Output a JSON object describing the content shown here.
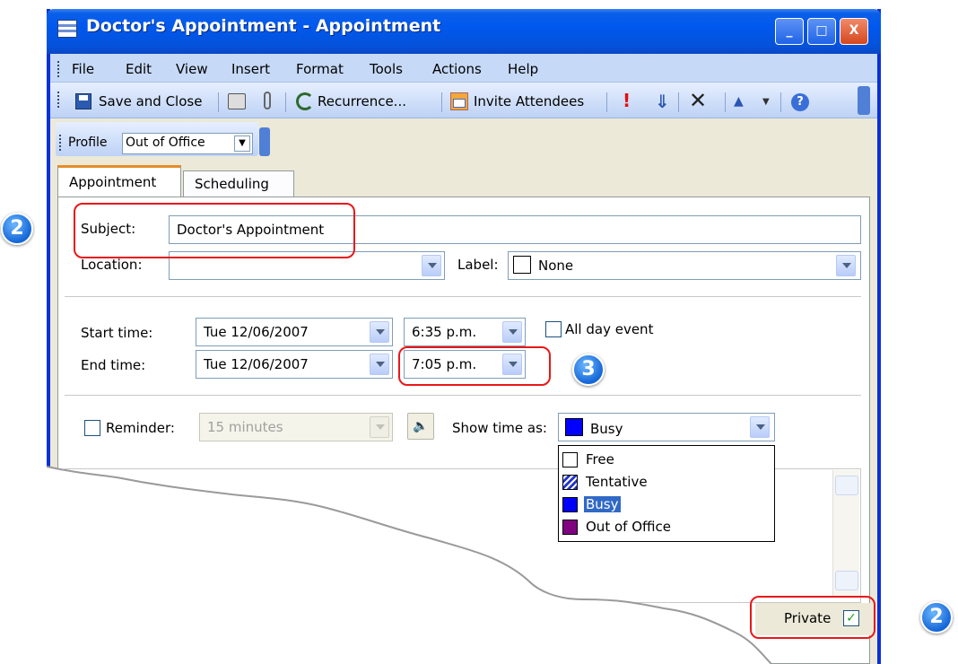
{
  "window": {
    "title": "Doctor's Appointment - Appointment",
    "controls": {
      "minimize": "_",
      "maximize": "□",
      "close": "X"
    }
  },
  "menu": [
    "File",
    "Edit",
    "View",
    "Insert",
    "Format",
    "Tools",
    "Actions",
    "Help"
  ],
  "toolbar": {
    "save_close": "Save and Close",
    "recurrence": "Recurrence...",
    "invite": "Invite Attendees"
  },
  "profile": {
    "label": "Profile",
    "value": "Out of Office"
  },
  "tabs": [
    "Appointment",
    "Scheduling"
  ],
  "form": {
    "subject_label": "Subject:",
    "subject_value": "Doctor's Appointment",
    "location_label": "Location:",
    "location_value": "",
    "label_label": "Label:",
    "label_value": "None",
    "start_label": "Start time:",
    "start_date": "Tue 12/06/2007",
    "start_time": "6:35 p.m.",
    "all_day_label": "All day event",
    "end_label": "End time:",
    "end_date": "Tue 12/06/2007",
    "end_time": "7:05 p.m.",
    "reminder_label": "Reminder:",
    "reminder_value": "15 minutes",
    "show_time_label": "Show time as:",
    "show_time_value": "Busy",
    "private_label": "Private"
  },
  "show_time_options": [
    {
      "label": "Free",
      "color": "#ffffff"
    },
    {
      "label": "Tentative",
      "color": "#2233cc"
    },
    {
      "label": "Busy",
      "color": "#0000ff"
    },
    {
      "label": "Out of Office",
      "color": "#800080"
    }
  ],
  "callouts": {
    "subject": "2",
    "end_time": "3",
    "private": "2"
  },
  "colors": {
    "title_bar": "#0058ee",
    "callout_box": "#e81818",
    "selected": "#3169c6"
  }
}
